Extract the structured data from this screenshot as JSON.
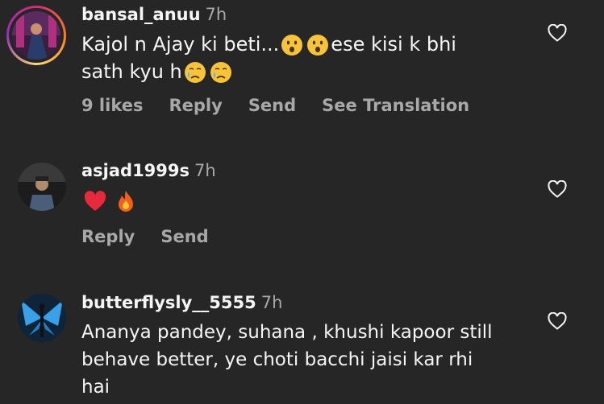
{
  "comments": [
    {
      "username": "bansal_anuu",
      "time": "7h",
      "line1_a": "Kajol n Ajay ki beti...",
      "line1_b": "ese kisi k bhi",
      "line2": "sath kyu h",
      "likes": "9 likes",
      "reply": "Reply",
      "send": "Send",
      "translate": "See Translation"
    },
    {
      "username": "asjad1999s",
      "time": "7h",
      "reply": "Reply",
      "send": "Send"
    },
    {
      "username": "butterflysly__5555",
      "time": "7h",
      "line1": "Ananya pandey, suhana , khushi kapoor still",
      "line2": "behave better, ye choti bacchi jaisi kar rhi",
      "line3": "hai"
    }
  ],
  "colors": {
    "background": "#262626",
    "text": "#f5f5f5",
    "muted": "#a8a8a8"
  }
}
